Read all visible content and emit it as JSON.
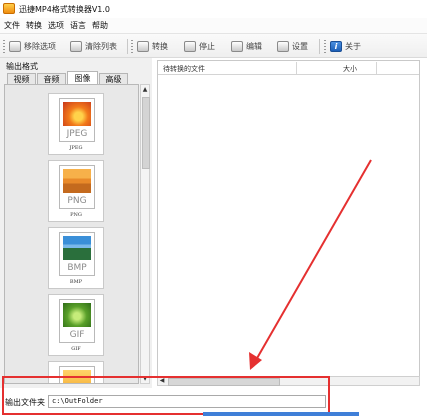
{
  "window": {
    "title": "迅捷MP4格式转换器V1.0"
  },
  "menu": {
    "items": [
      "文件",
      "转换",
      "选项",
      "语言",
      "帮助"
    ]
  },
  "toolbar": {
    "remove_selected": "移除选项",
    "clear_list": "清除列表",
    "convert": "转换",
    "stop": "停止",
    "edit": "编辑",
    "settings": "设置",
    "about": "关于"
  },
  "left_panel": {
    "title": "输出格式",
    "tabs": [
      "视频",
      "音频",
      "图像",
      "高级"
    ],
    "active_tab": "图像",
    "formats": [
      {
        "ext": "JPEG",
        "name": "JPEG"
      },
      {
        "ext": "PNG",
        "name": "PNG"
      },
      {
        "ext": "BMP",
        "name": "BMP"
      },
      {
        "ext": "GIF",
        "name": "GIF"
      }
    ]
  },
  "file_list": {
    "columns": [
      "待转换的文件",
      "大小"
    ]
  },
  "output": {
    "label": "输出文件夹",
    "path": "c:\\OutFolder"
  },
  "colors": {
    "annotation": "#e53030",
    "selection": "#3f7fd8"
  }
}
